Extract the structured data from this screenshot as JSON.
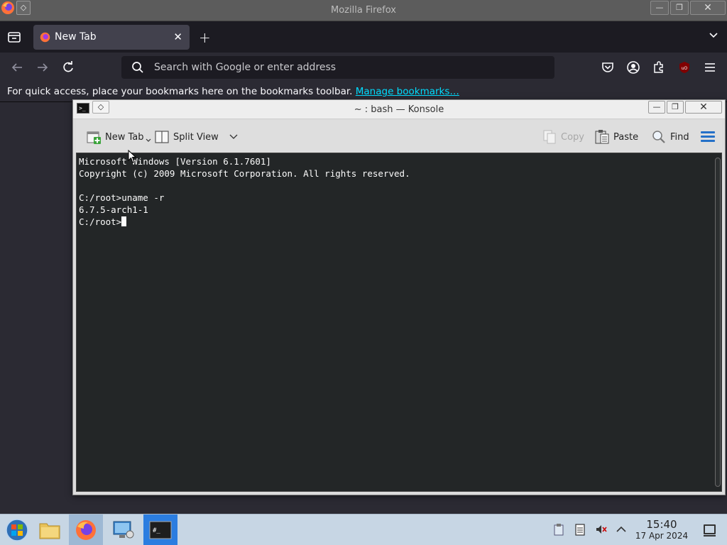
{
  "firefox": {
    "window_title": "Mozilla Firefox",
    "tab_title": "New Tab",
    "url_placeholder": "Search with Google or enter address",
    "bookmarks_text": "For quick access, place your bookmarks here on the bookmarks toolbar.",
    "bookmarks_link": "Manage bookmarks…",
    "new_tab_symbol": "+",
    "close_tab_symbol": "✕"
  },
  "konsole": {
    "title": "~ : bash — Konsole",
    "toolbar": {
      "new_tab": "New Tab",
      "split_view": "Split View",
      "copy": "Copy",
      "paste": "Paste",
      "find": "Find"
    },
    "terminal_lines": [
      "Microsoft Windows [Version 6.1.7601]",
      "Copyright (c) 2009 Microsoft Corporation. All rights reserved.",
      "",
      "C:/root>uname -r",
      "6.7.5-arch1-1"
    ],
    "prompt": "C:/root>"
  },
  "taskbar": {
    "time": "15:40",
    "date": "17 Apr 2024"
  },
  "colors": {
    "firefox_dark": "#1c1b22",
    "firefox_toolbar": "#2b2a33",
    "link": "#00ddff",
    "terminal_bg": "#232627",
    "taskbar_bg": "#c7d6e4",
    "hamburger_accent": "#2470c8"
  }
}
